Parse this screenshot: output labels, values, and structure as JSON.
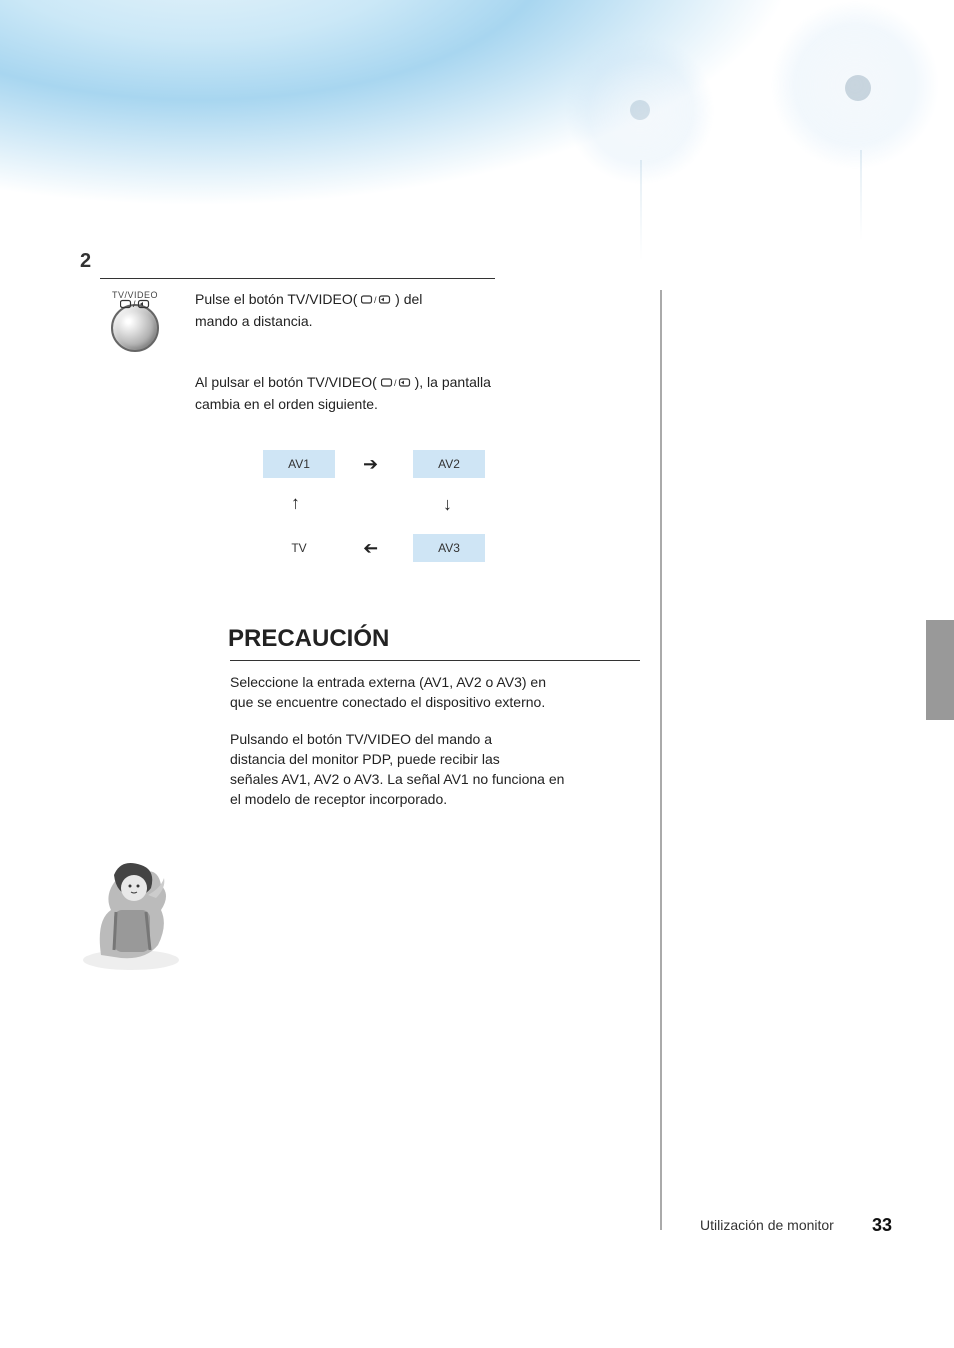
{
  "section_number": "2",
  "step": {
    "line1_prefix": "Pulse el botón TV/VIDEO( ",
    "line1_suffix": " ) del",
    "line2": "mando a distancia.",
    "line3_prefix": "Al pulsar el botón TV/VIDEO(",
    "line3_suffix": "), la pantalla",
    "line4": "cambia en el orden siguiente."
  },
  "btn_label": "TV/VIDEO",
  "cycle": {
    "av1": "AV1",
    "av2": "AV2",
    "av3": "AV3",
    "tv": "TV"
  },
  "caution": {
    "heading": "PRECAUCIÓN",
    "p1": "Seleccione la entrada externa (AV1, AV2 o AV3) en que se encuentre conectado el dispositivo externo.",
    "p2_a": "Pulsando el botón TV/VIDEO del mando a",
    "p2_b": "distancia del monitor PDP, puede recibir las",
    "p2_c": "señales AV1, AV2 o AV3. La señal AV1 no funciona en el modelo de receptor incorporado."
  },
  "footer": {
    "label": "Utilización de monitor",
    "page": "33"
  }
}
